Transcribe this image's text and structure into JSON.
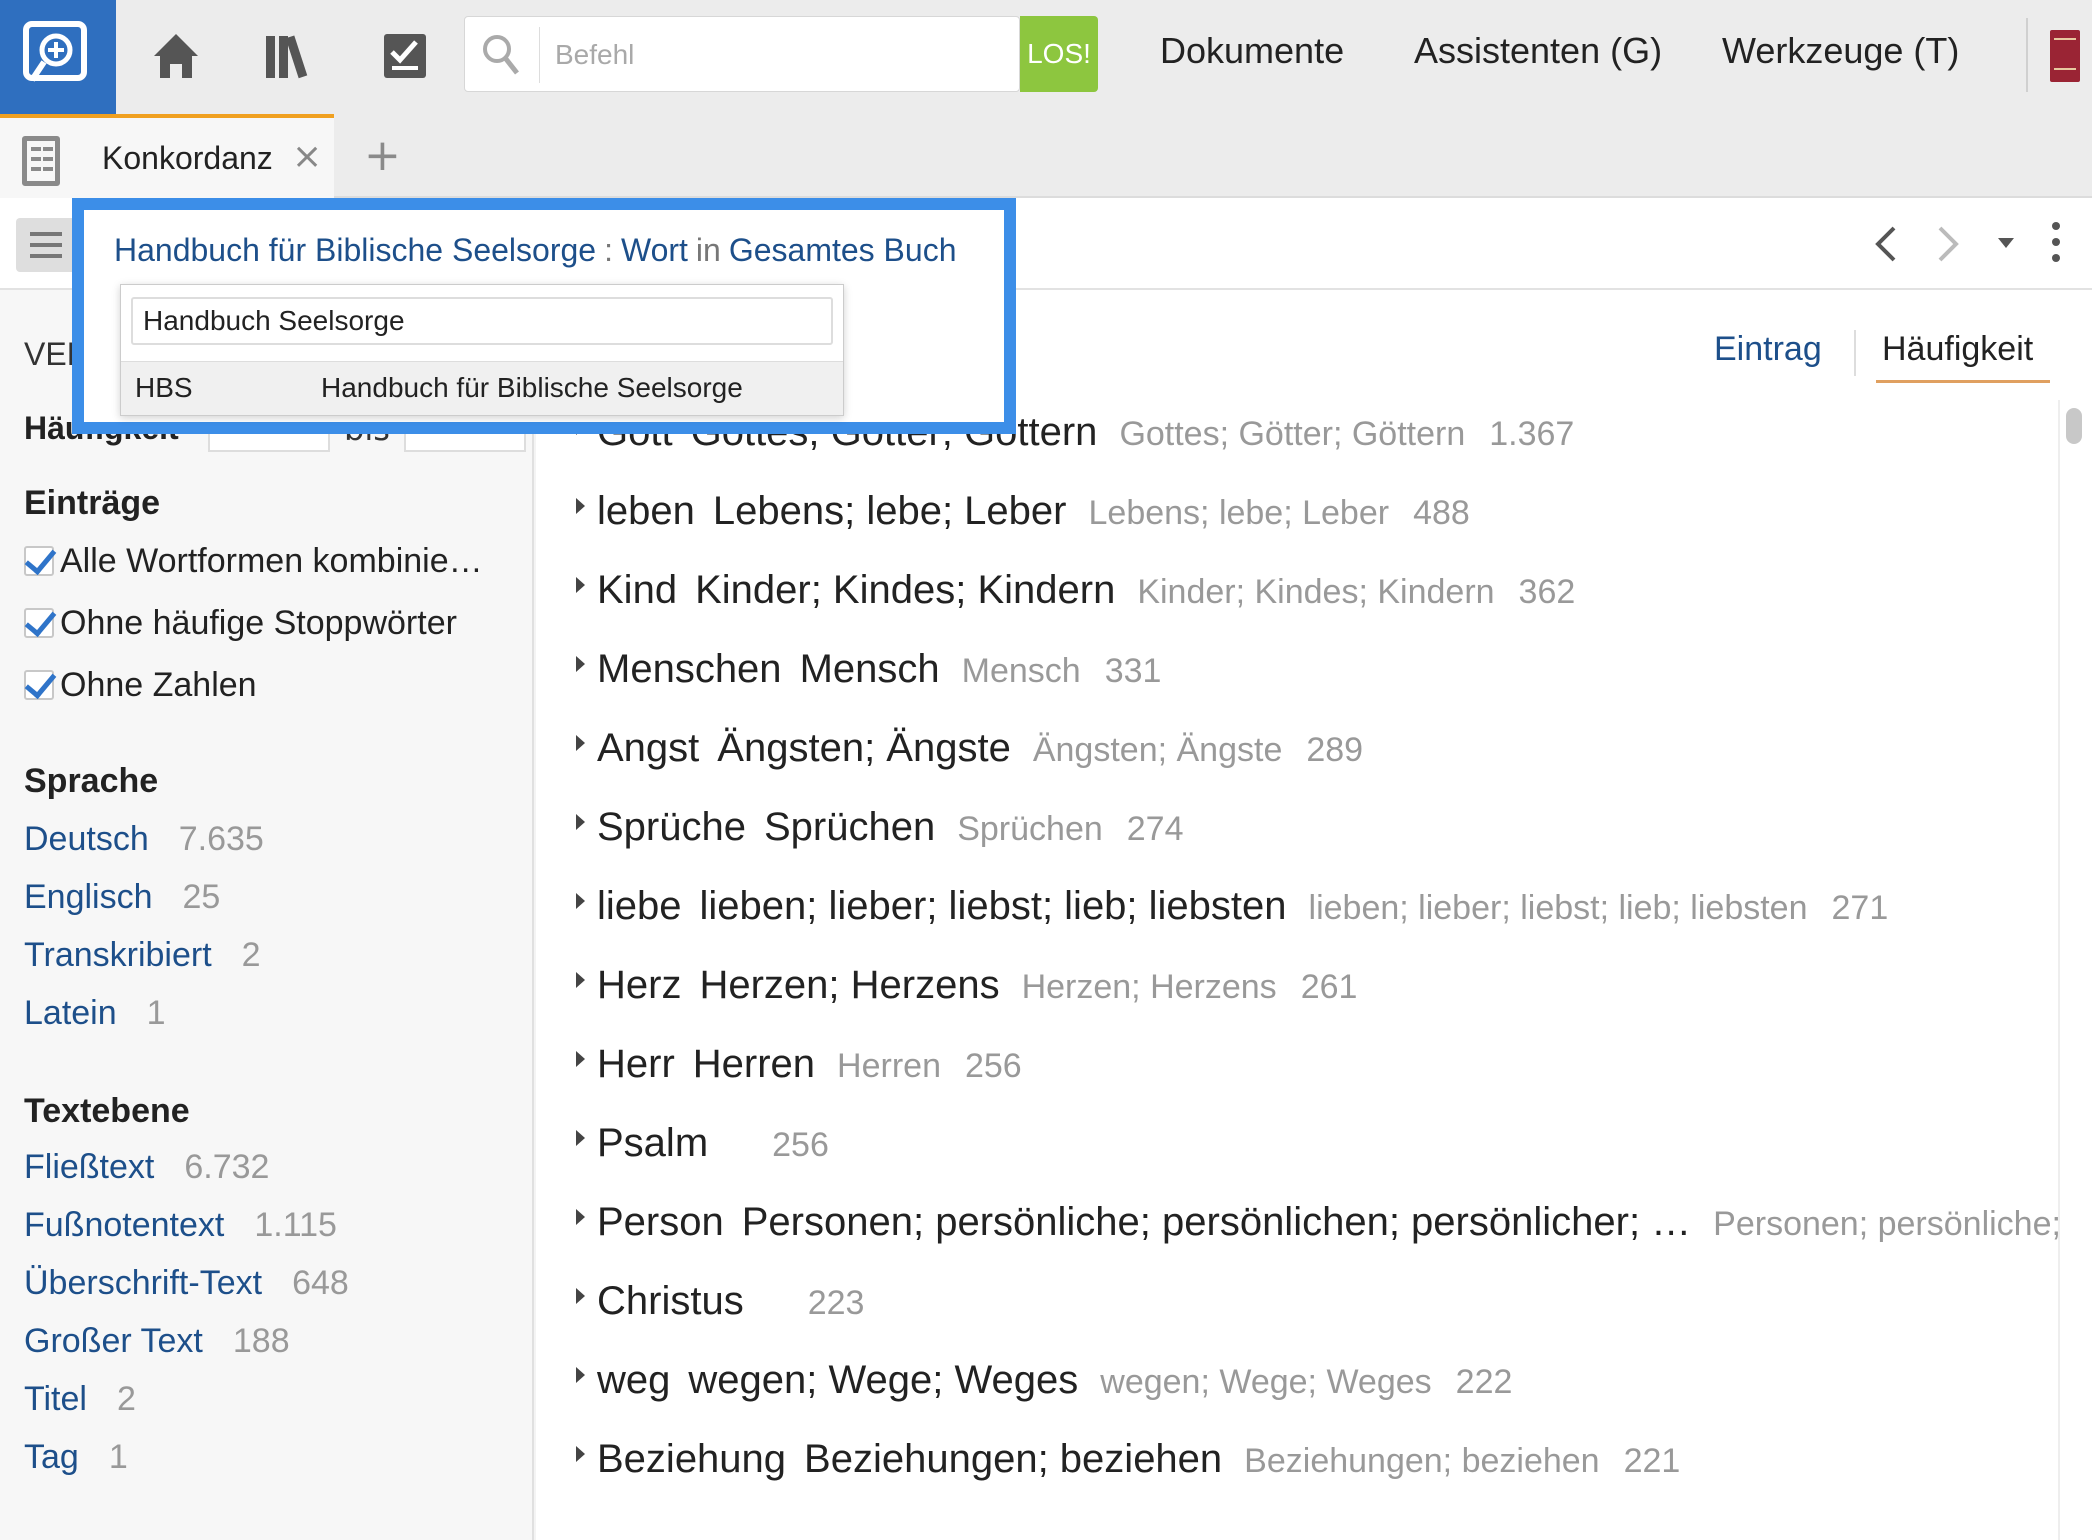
{
  "topbar": {
    "command_placeholder": "Befehl",
    "go_label": "LOS!",
    "menu": [
      "Dokumente",
      "Assistenten (G)",
      "Werkzeuge (T)"
    ]
  },
  "tab": {
    "label": "Konkordanz",
    "close": "×",
    "add": "+"
  },
  "crumb": {
    "resource": "Handbuch für Biblische Seelsorge",
    "colon": ":",
    "unit": "Wort",
    "in": "in",
    "scope": "Gesamtes Buch"
  },
  "dropdown": {
    "input_value": "Handbuch Seelsorge",
    "result_abbr": "HBS",
    "result_title": "Handbuch für Biblische Seelsorge"
  },
  "left": {
    "header_cut": "VERFE",
    "freq_label": "Häufigkeit",
    "bis": "bis",
    "entries_title": "Einträge",
    "checkboxes": [
      "Alle Wortformen kombinie…",
      "Ohne häufige Stoppwörter",
      "Ohne Zahlen"
    ],
    "language_title": "Sprache",
    "languages": [
      {
        "label": "Deutsch",
        "count": "7.635"
      },
      {
        "label": "Englisch",
        "count": "25"
      },
      {
        "label": "Transkribiert",
        "count": "2"
      },
      {
        "label": "Latein",
        "count": "1"
      }
    ],
    "textlevel_title": "Textebene",
    "textlevels": [
      {
        "label": "Fließtext",
        "count": "6.732"
      },
      {
        "label": "Fußnotentext",
        "count": "1.115"
      },
      {
        "label": "Überschrift-Text",
        "count": "648"
      },
      {
        "label": "Großer Text",
        "count": "188"
      },
      {
        "label": "Titel",
        "count": "2"
      },
      {
        "label": "Tag",
        "count": "1"
      }
    ]
  },
  "sort": {
    "entry": "Eintrag",
    "frequency": "Häufigkeit"
  },
  "rows": [
    {
      "word": "Gott",
      "forms": "Gottes; Götter; Göttern",
      "grey": "Gottes; Götter; Göttern",
      "count": "1.367"
    },
    {
      "word": "leben",
      "forms": "Lebens; lebe; Leber",
      "grey": "Lebens; lebe; Leber",
      "count": "488"
    },
    {
      "word": "Kind",
      "forms": "Kinder; Kindes; Kindern",
      "grey": "Kinder; Kindes; Kindern",
      "count": "362"
    },
    {
      "word": "Menschen",
      "forms": "Mensch",
      "grey": "Mensch",
      "count": "331"
    },
    {
      "word": "Angst",
      "forms": "Ängsten; Ängste",
      "grey": "Ängsten; Ängste",
      "count": "289"
    },
    {
      "word": "Sprüche",
      "forms": "Sprüchen",
      "grey": "Sprüchen",
      "count": "274"
    },
    {
      "word": "liebe",
      "forms": "lieben; lieber; liebst; lieb; liebsten",
      "grey": "lieben; lieber; liebst; lieb; liebsten",
      "count": "271"
    },
    {
      "word": "Herz",
      "forms": "Herzen; Herzens",
      "grey": "Herzen; Herzens",
      "count": "261"
    },
    {
      "word": "Herr",
      "forms": "Herren",
      "grey": "Herren",
      "count": "256"
    },
    {
      "word": "Psalm",
      "forms": "",
      "grey": "",
      "count": "256"
    },
    {
      "word": "Person",
      "forms": "Personen; persönliche; persönlichen; persönlicher; …",
      "grey": "Personen; persönliche;",
      "count": ""
    },
    {
      "word": "Christus",
      "forms": "",
      "grey": "",
      "count": "223"
    },
    {
      "word": "weg",
      "forms": "wegen; Wege; Weges",
      "grey": "wegen; Wege; Weges",
      "count": "222"
    },
    {
      "word": "Beziehung",
      "forms": "Beziehungen; beziehen",
      "grey": "Beziehungen; beziehen",
      "count": "221"
    }
  ],
  "colors": {
    "accent": "#3c8ee8",
    "go": "#8dc63f",
    "link": "#1d4f8a",
    "logo": "#2f6fbf"
  }
}
